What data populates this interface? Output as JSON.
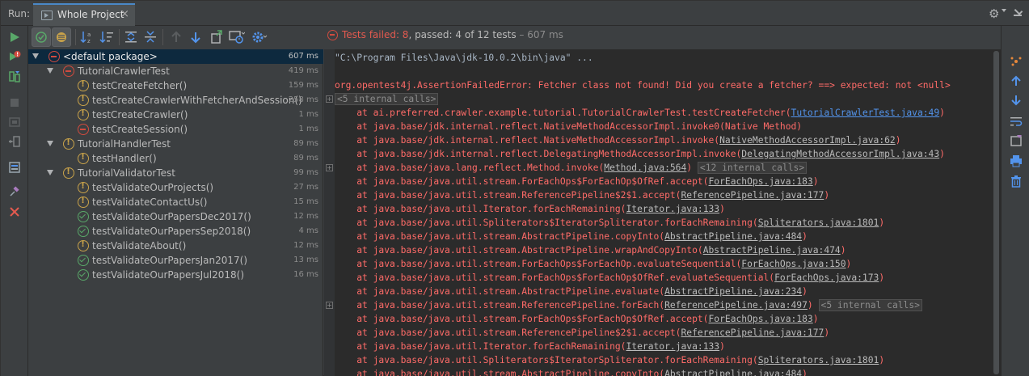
{
  "topbar": {
    "run_label": "Run:",
    "tab_label": "Whole Project",
    "tab_close": "×"
  },
  "left_toolbar": {
    "icons": [
      "rerun-icon",
      "rerun-failed-icon",
      "toggle-auto-test-icon",
      "stop-icon",
      "exit-icon",
      "import-test-icon",
      "layout-icon",
      "pin-icon",
      "close-icon"
    ]
  },
  "test_toolbar": {
    "icons": [
      "show-passed-icon",
      "show-ignored-icon",
      "sort-alpha-icon",
      "sort-duration-icon",
      "expand-all-icon",
      "collapse-all-icon",
      "prev-failed-icon",
      "next-failed-icon",
      "export-icon",
      "history-icon",
      "settings-icon"
    ]
  },
  "tree": {
    "rows": [
      {
        "name": "<default package>",
        "time": "607 ms",
        "status": "fail",
        "level": 0,
        "expanded": true,
        "selected": true
      },
      {
        "name": "TutorialCrawlerTest",
        "time": "419 ms",
        "status": "fail",
        "level": 1,
        "expanded": true
      },
      {
        "name": "testCreateFetcher()",
        "time": "159 ms",
        "status": "warn",
        "level": 2
      },
      {
        "name": "testCreateCrawlerWithFetcherAndSession()",
        "time": "258 ms",
        "status": "warn",
        "level": 2
      },
      {
        "name": "testCreateCrawler()",
        "time": "1 ms",
        "status": "warn",
        "level": 2
      },
      {
        "name": "testCreateSession()",
        "time": "1 ms",
        "status": "fail",
        "level": 2
      },
      {
        "name": "TutorialHandlerTest",
        "time": "89 ms",
        "status": "warn",
        "level": 1,
        "expanded": true
      },
      {
        "name": "testHandler()",
        "time": "89 ms",
        "status": "warn",
        "level": 2
      },
      {
        "name": "TutorialValidatorTest",
        "time": "99 ms",
        "status": "warn",
        "level": 1,
        "expanded": true
      },
      {
        "name": "testValidateOurProjects()",
        "time": "27 ms",
        "status": "warn",
        "level": 2
      },
      {
        "name": "testValidateContactUs()",
        "time": "15 ms",
        "status": "warn",
        "level": 2
      },
      {
        "name": "testValidateOurPapersDec2017()",
        "time": "12 ms",
        "status": "pass",
        "level": 2
      },
      {
        "name": "testValidateOurPapersSep2018()",
        "time": "4 ms",
        "status": "pass",
        "level": 2
      },
      {
        "name": "testValidateAbout()",
        "time": "12 ms",
        "status": "warn",
        "level": 2
      },
      {
        "name": "testValidateOurPapersJan2017()",
        "time": "13 ms",
        "status": "pass",
        "level": 2
      },
      {
        "name": "testValidateOurPapersJul2018()",
        "time": "16 ms",
        "status": "pass",
        "level": 2
      }
    ]
  },
  "console_header": {
    "failed": "Tests failed: 8",
    "passed": ", passed: 4 of 12 tests",
    "time": " – 607 ms"
  },
  "console": {
    "lines": [
      {
        "type": "cmd",
        "text": "\"C:\\Program Files\\Java\\jdk-10.0.2\\bin\\java\" ..."
      },
      {
        "type": "blank",
        "text": ""
      },
      {
        "type": "err",
        "text": "org.opentest4j.AssertionFailedError: Fetcher class not found! Did you create a fetcher? ==> expected: not <null>"
      },
      {
        "type": "internal",
        "text": "<5 internal calls>",
        "fold": true
      },
      {
        "type": "at",
        "pre": "    at ai.preferred.crawler.example.tutorial.TutorialCrawlerTest.testCreateFetcher(",
        "link": "TutorialCrawlerTest.java:49",
        "link_style": "blue",
        "post": ")"
      },
      {
        "type": "at",
        "pre": "    at java.base/jdk.internal.reflect.NativeMethodAccessorImpl.invoke0(Native Method)",
        "link": "",
        "post": ""
      },
      {
        "type": "at",
        "pre": "    at java.base/jdk.internal.reflect.NativeMethodAccessorImpl.invoke(",
        "link": "NativeMethodAccessorImpl.java:62",
        "link_style": "grey",
        "post": ")"
      },
      {
        "type": "at",
        "pre": "    at java.base/jdk.internal.reflect.DelegatingMethodAccessorImpl.invoke(",
        "link": "DelegatingMethodAccessorImpl.java:43",
        "link_style": "grey",
        "post": ")"
      },
      {
        "type": "at",
        "pre": "    at java.base/java.lang.reflect.Method.invoke(",
        "link": "Method.java:564",
        "link_style": "grey",
        "post": ") ",
        "internal": "<12 internal calls>",
        "fold": true
      },
      {
        "type": "at",
        "pre": "    at java.base/java.util.stream.ForEachOps$ForEachOp$OfRef.accept(",
        "link": "ForEachOps.java:183",
        "link_style": "grey",
        "post": ")"
      },
      {
        "type": "at",
        "pre": "    at java.base/java.util.stream.ReferencePipeline$2$1.accept(",
        "link": "ReferencePipeline.java:177",
        "link_style": "grey",
        "post": ")"
      },
      {
        "type": "at",
        "pre": "    at java.base/java.util.Iterator.forEachRemaining(",
        "link": "Iterator.java:133",
        "link_style": "grey",
        "post": ")"
      },
      {
        "type": "at",
        "pre": "    at java.base/java.util.Spliterators$IteratorSpliterator.forEachRemaining(",
        "link": "Spliterators.java:1801",
        "link_style": "grey",
        "post": ")"
      },
      {
        "type": "at",
        "pre": "    at java.base/java.util.stream.AbstractPipeline.copyInto(",
        "link": "AbstractPipeline.java:484",
        "link_style": "grey",
        "post": ")"
      },
      {
        "type": "at",
        "pre": "    at java.base/java.util.stream.AbstractPipeline.wrapAndCopyInto(",
        "link": "AbstractPipeline.java:474",
        "link_style": "grey",
        "post": ")"
      },
      {
        "type": "at",
        "pre": "    at java.base/java.util.stream.ForEachOps$ForEachOp.evaluateSequential(",
        "link": "ForEachOps.java:150",
        "link_style": "grey",
        "post": ")"
      },
      {
        "type": "at",
        "pre": "    at java.base/java.util.stream.ForEachOps$ForEachOp$OfRef.evaluateSequential(",
        "link": "ForEachOps.java:173",
        "link_style": "grey",
        "post": ")"
      },
      {
        "type": "at",
        "pre": "    at java.base/java.util.stream.AbstractPipeline.evaluate(",
        "link": "AbstractPipeline.java:234",
        "link_style": "grey",
        "post": ")"
      },
      {
        "type": "at",
        "pre": "    at java.base/java.util.stream.ReferencePipeline.forEach(",
        "link": "ReferencePipeline.java:497",
        "link_style": "grey",
        "post": ") ",
        "internal": "<5 internal calls>",
        "fold": true
      },
      {
        "type": "at",
        "pre": "    at java.base/java.util.stream.ForEachOps$ForEachOp$OfRef.accept(",
        "link": "ForEachOps.java:183",
        "link_style": "grey",
        "post": ")"
      },
      {
        "type": "at",
        "pre": "    at java.base/java.util.stream.ReferencePipeline$2$1.accept(",
        "link": "ReferencePipeline.java:177",
        "link_style": "grey",
        "post": ")"
      },
      {
        "type": "at",
        "pre": "    at java.base/java.util.Iterator.forEachRemaining(",
        "link": "Iterator.java:133",
        "link_style": "grey",
        "post": ")"
      },
      {
        "type": "at",
        "pre": "    at java.base/java.util.Spliterators$IteratorSpliterator.forEachRemaining(",
        "link": "Spliterators.java:1801",
        "link_style": "grey",
        "post": ")"
      },
      {
        "type": "at",
        "pre": "    at java.base/java.util.stream.AbstractPipeline.copyInto(",
        "link": "AbstractPipeline.java:484",
        "link_style": "grey",
        "post": ")"
      }
    ]
  },
  "right_toolbar": {
    "icons": [
      "layout-icon",
      "up-arrow-icon",
      "down-arrow-icon",
      "soft-wrap-icon",
      "scroll-to-end-icon",
      "print-icon",
      "trash-icon"
    ]
  },
  "colors": {
    "fail": "#d14b3f",
    "warn": "#c8a24a",
    "pass": "#59a869",
    "console_error": "#ff6b68",
    "link": "#5394ec",
    "selection": "#0d293e"
  }
}
